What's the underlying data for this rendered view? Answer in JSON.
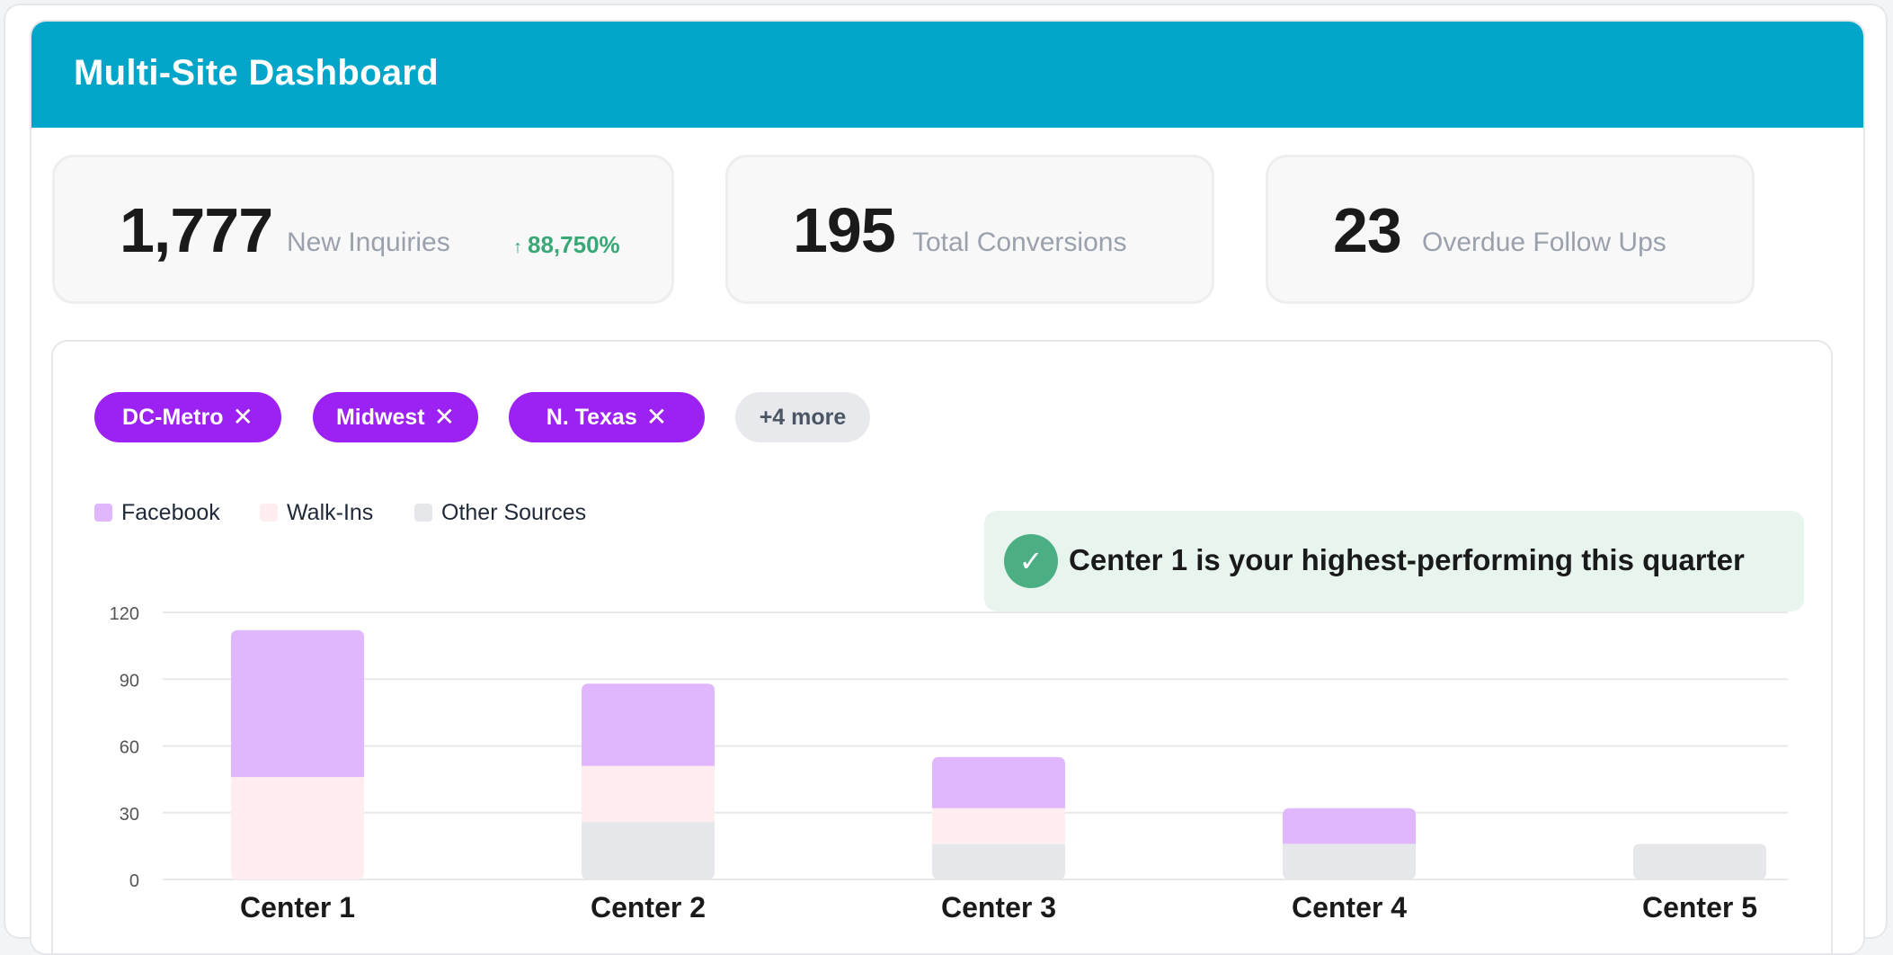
{
  "header": {
    "title": "Multi-Site Dashboard"
  },
  "kpis": [
    {
      "value": "1,777",
      "label": "New Inquiries",
      "trend": "88,750%",
      "trend_direction": "up"
    },
    {
      "value": "195",
      "label": "Total Conversions"
    },
    {
      "value": "23",
      "label": "Overdue Follow Ups"
    }
  ],
  "filters": {
    "chips": [
      "DC-Metro",
      "Midwest",
      "N. Texas"
    ],
    "more_label": "+4 more"
  },
  "insight": {
    "icon": "check-icon",
    "text": "Center 1 is your highest-performing this quarter"
  },
  "colors": {
    "header": "#00a6c9",
    "chip": "#9b22f2",
    "facebook": "#e0b6fc",
    "walkins": "#ffedf0",
    "other": "#e6e7eb",
    "trend": "#3aa876",
    "insight_bg": "#e8f5ef",
    "insight_icon": "#4caf84"
  },
  "chart_data": {
    "type": "bar",
    "stacked": true,
    "categories": [
      "Center 1",
      "Center 2",
      "Center 3",
      "Center 4",
      "Center 5"
    ],
    "series": [
      {
        "name": "Other Sources",
        "values": [
          0,
          26,
          16,
          16,
          16
        ]
      },
      {
        "name": "Walk-Ins",
        "values": [
          46,
          25,
          16,
          0,
          0
        ]
      },
      {
        "name": "Facebook",
        "values": [
          66,
          37,
          23,
          16,
          0
        ]
      }
    ],
    "yticks": [
      0,
      30,
      60,
      90,
      120
    ],
    "ylim": [
      0,
      120
    ],
    "legend_placement": "top-left",
    "grid": true
  }
}
